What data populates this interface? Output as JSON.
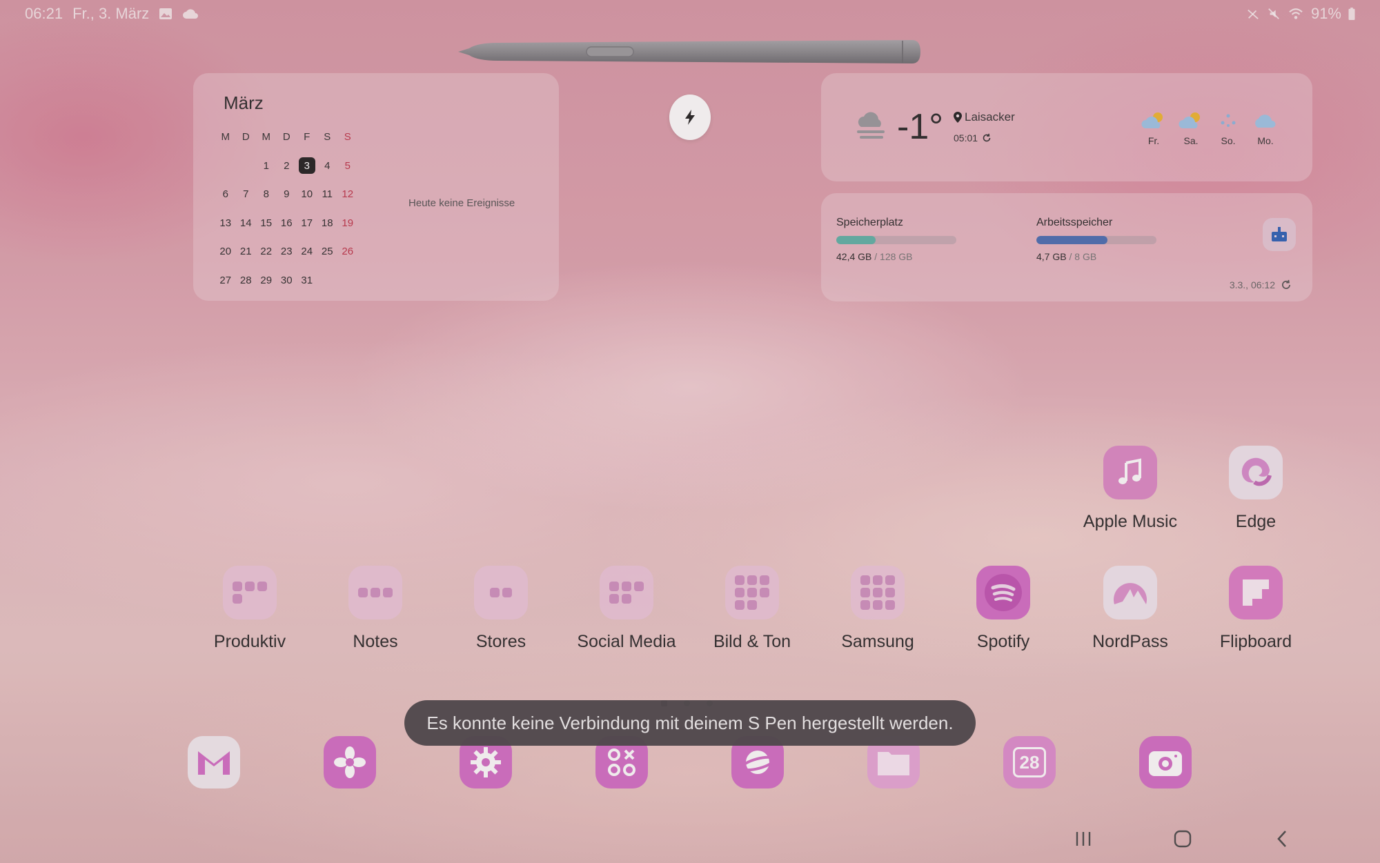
{
  "status_bar": {
    "time": "06:21",
    "date": "Fr., 3. März",
    "battery": "91%",
    "icons": [
      "gallery-icon",
      "cloud-icon",
      "pen-off-icon",
      "mute-icon",
      "wifi-icon",
      "battery-icon"
    ]
  },
  "calendar": {
    "month": "März",
    "weekdays": [
      "M",
      "D",
      "M",
      "D",
      "F",
      "S",
      "S"
    ],
    "weeks": [
      [
        "",
        "",
        "1",
        "2",
        "3",
        "4",
        "5"
      ],
      [
        "6",
        "7",
        "8",
        "9",
        "10",
        "11",
        "12"
      ],
      [
        "13",
        "14",
        "15",
        "16",
        "17",
        "18",
        "19"
      ],
      [
        "20",
        "21",
        "22",
        "23",
        "24",
        "25",
        "26"
      ],
      [
        "27",
        "28",
        "29",
        "30",
        "31",
        "",
        ""
      ]
    ],
    "today": "3",
    "no_events": "Heute keine Ereignisse"
  },
  "weather": {
    "temperature": "-1°",
    "location": "Laisacker",
    "updated": "05:01",
    "forecast": [
      {
        "day": "Fr.",
        "icon": "partly-cloudy-icon"
      },
      {
        "day": "Sa.",
        "icon": "partly-cloudy-icon"
      },
      {
        "day": "So.",
        "icon": "snow-icon"
      },
      {
        "day": "Mo.",
        "icon": "cloud-icon"
      }
    ]
  },
  "storage": {
    "storage_label": "Speicherplatz",
    "storage_used": "42,4 GB",
    "storage_total": " / 128 GB",
    "storage_fraction": 0.33,
    "ram_label": "Arbeitsspeicher",
    "ram_used": "4,7 GB",
    "ram_total": " / 8 GB",
    "ram_fraction": 0.59,
    "updated": "3.3., 06:12",
    "colors": {
      "storage": "#5fb3a8",
      "ram": "#4a6fb3"
    }
  },
  "apps": {
    "apple_music": "Apple Music",
    "edge": "Edge",
    "produktiv": "Produktiv",
    "notes": "Notes",
    "stores": "Stores",
    "social_media": "Social Media",
    "bild_ton": "Bild & Ton",
    "samsung": "Samsung",
    "spotify": "Spotify",
    "nordpass": "NordPass",
    "flipboard": "Flipboard"
  },
  "dock": {
    "calendar_day": "28"
  },
  "toast": {
    "message": "Es konnte keine Verbindung mit deinem S Pen hergestellt werden."
  }
}
